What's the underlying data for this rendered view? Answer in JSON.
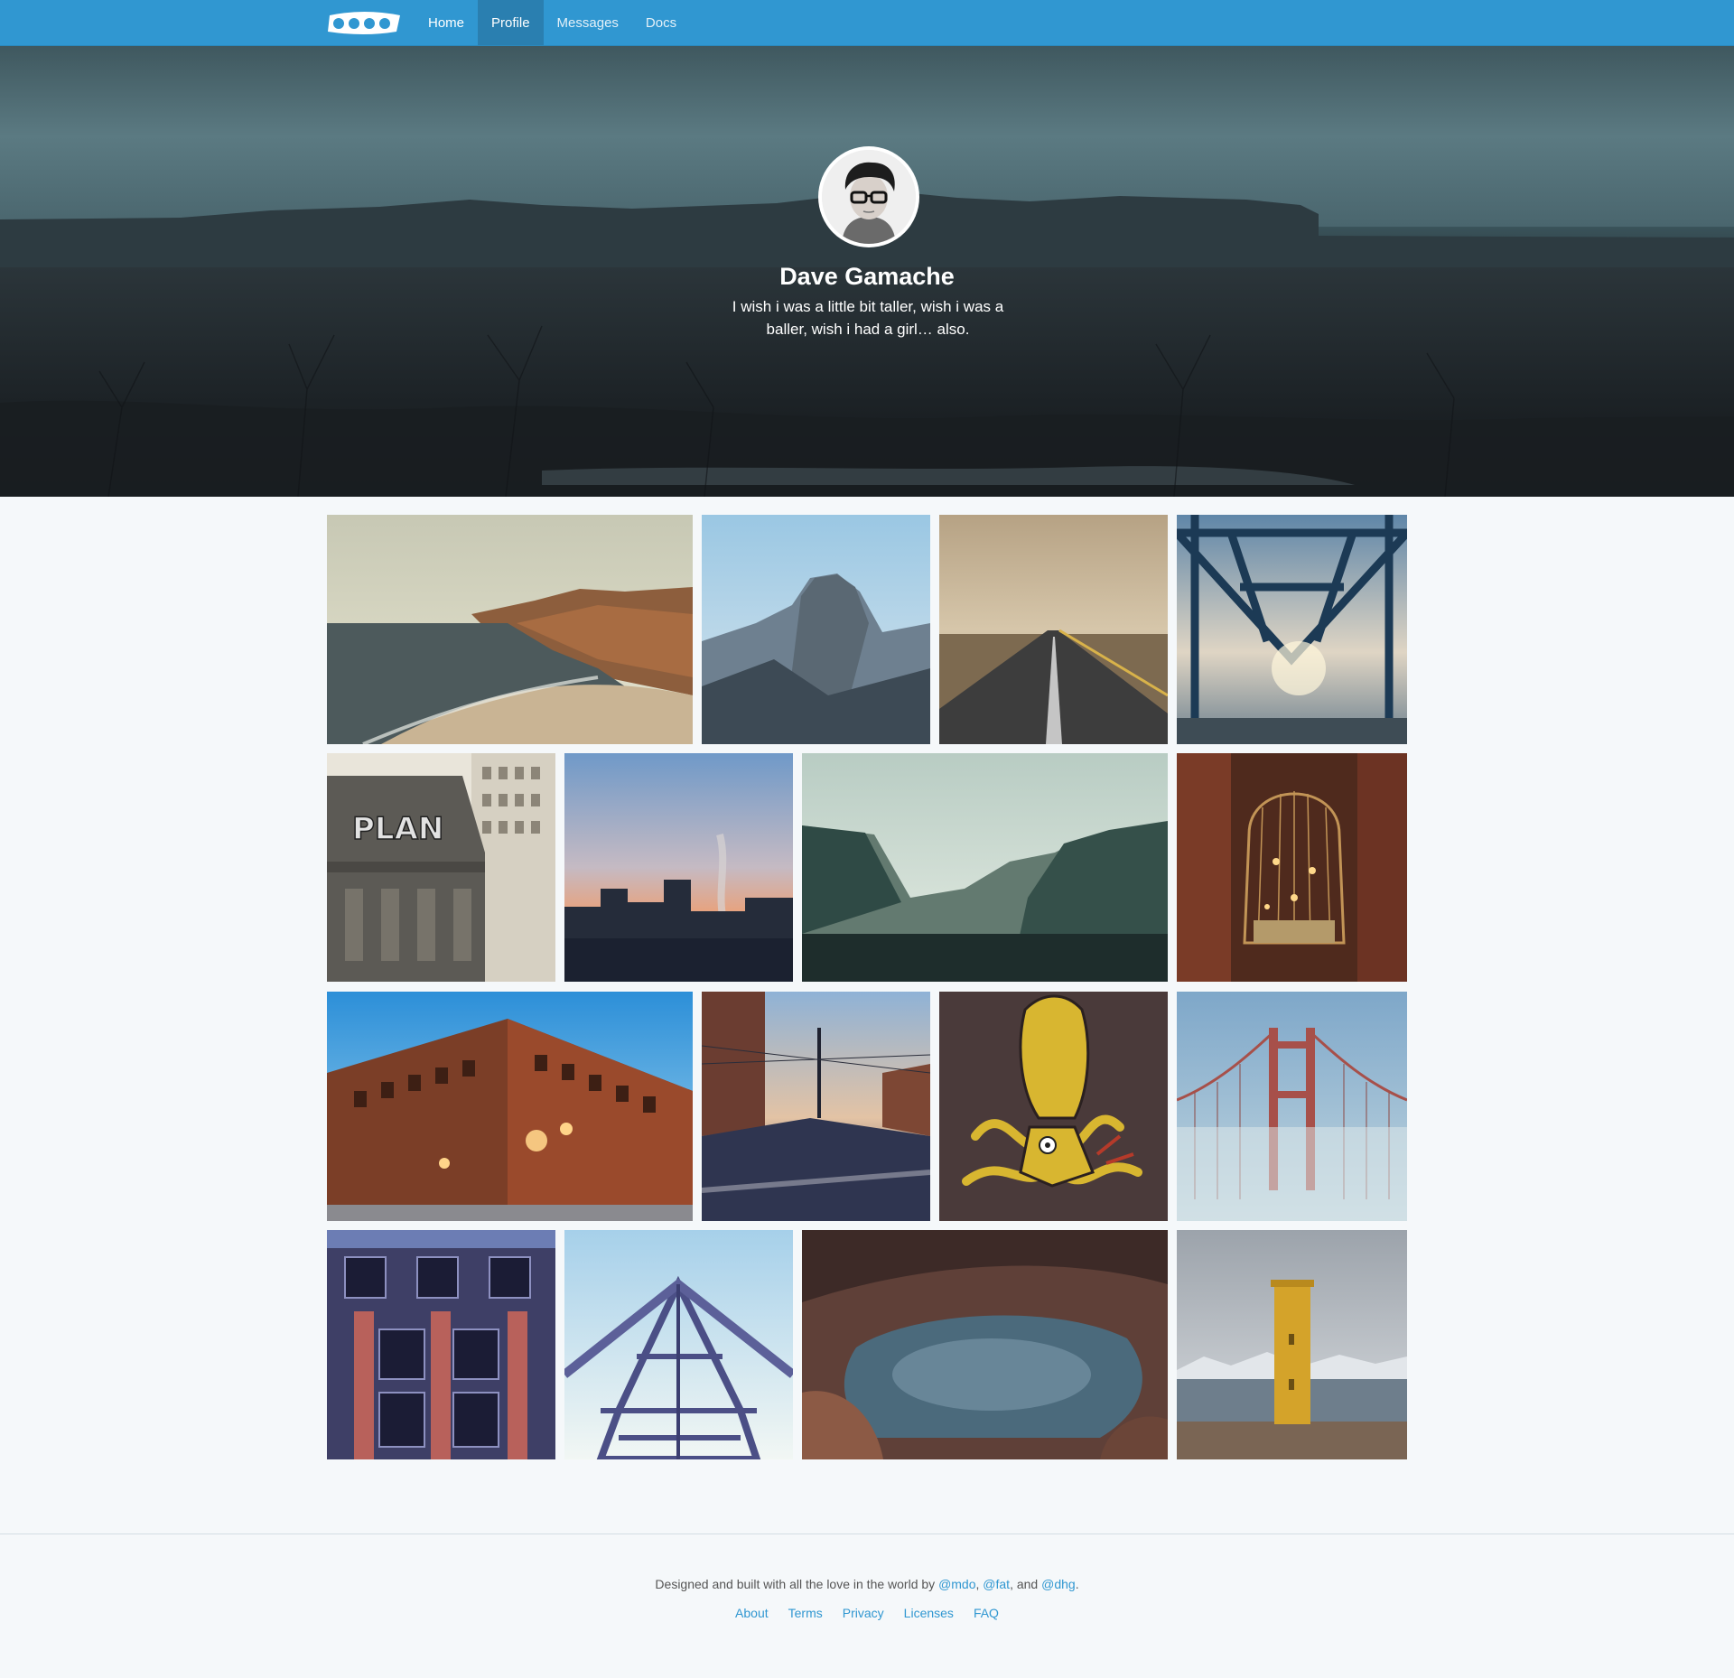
{
  "navbar": {
    "brand": "brand-logo",
    "links": [
      {
        "label": "Home",
        "active": false
      },
      {
        "label": "Profile",
        "active": true
      },
      {
        "label": "Messages",
        "active": false
      },
      {
        "label": "Docs",
        "active": false
      }
    ]
  },
  "profile": {
    "name": "Dave Gamache",
    "bio": "I wish i was a little bit taller, wish i was a baller, wish i had a girl… also."
  },
  "gallery": {
    "photos": [
      "coastal-cliffs-beach",
      "half-dome-mountain",
      "desert-highway",
      "steel-bridge-truss",
      "graffiti-building",
      "city-sunset-smokestack",
      "yosemite-valley",
      "birdcage-lights",
      "brick-warehouse-night",
      "street-intersection",
      "squid-deer-mural",
      "golden-gate-fog",
      "brick-facade-windows",
      "observation-tower",
      "cave-hot-spring",
      "yellow-lighthouse"
    ]
  },
  "footer": {
    "credit_prefix": "Designed and built with all the love in the world by ",
    "author_1": "@mdo",
    "sep_1": ", ",
    "author_2": "@fat",
    "sep_2": ", and ",
    "author_3": "@dhg",
    "credit_suffix": ".",
    "links": [
      "About",
      "Terms",
      "Privacy",
      "Licenses",
      "FAQ"
    ]
  },
  "colors": {
    "navbar": "#3097d1",
    "link": "#3097d1",
    "page_background": "#f5f8fa"
  }
}
